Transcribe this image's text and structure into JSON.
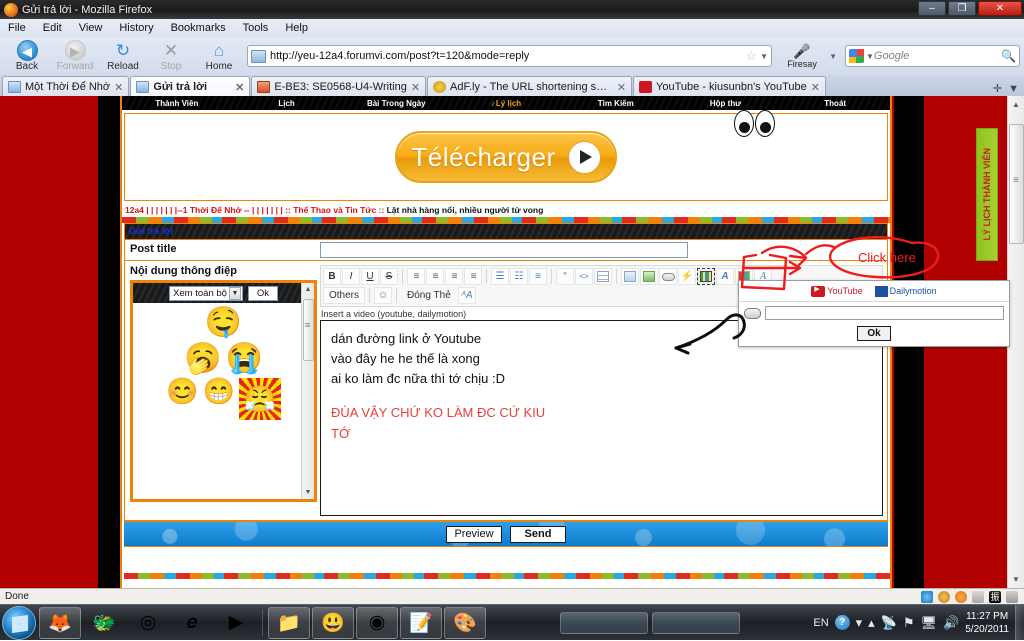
{
  "window": {
    "title": "Gửi trả lời - Mozilla Firefox",
    "minimize": "–",
    "maximize": "❐",
    "close": "✕"
  },
  "menubar": {
    "items": [
      "File",
      "Edit",
      "View",
      "History",
      "Bookmarks",
      "Tools",
      "Help"
    ]
  },
  "navbar": {
    "back": "Back",
    "forward": "Forward",
    "reload": "Reload",
    "stop": "Stop",
    "home": "Home",
    "url": "http://yeu-12a4.forumvi.com/post?t=120&mode=reply",
    "firesay": "Firesay",
    "search_placeholder": "Google"
  },
  "tabs": [
    {
      "label": "Một Thời Để Nhớ",
      "favicon": "page-icon",
      "active": false
    },
    {
      "label": "Gửi trả lời",
      "favicon": "page-icon",
      "active": true
    },
    {
      "label": "E-BE3: SE0568-U4-Writing",
      "favicon": "powerpoint-icon",
      "active": false
    },
    {
      "label": "AdF.ly - The URL shortening servic...",
      "favicon": "adfly-icon",
      "active": false
    },
    {
      "label": "YouTube - kiusunbn's YouTube",
      "favicon": "youtube-icon",
      "active": false
    }
  ],
  "forum": {
    "nav": [
      "Thành Viên",
      "Lịch",
      "Bài Trong Ngày",
      "Lý lịch",
      "Tìm Kiếm",
      "Hộp thư",
      "Thoát"
    ],
    "nav_active_index": 3,
    "banner_button": "Télécharger",
    "breadcrumb_primary": "12a4 | | | | | | |--1 Thời Để Nhớ -- | | | | | | |",
    "breadcrumb_section": ":: Thể Thao và Tin Tức ::",
    "breadcrumb_topic": "Lật nhà hàng nổi, nhiều người tử vong",
    "member_tab": "LÝ LỊCH THÀNH VIÊN"
  },
  "reply_form": {
    "header": "Gửi trả lời",
    "post_title_label": "Post title",
    "post_title_value": "",
    "message_label": "Nội dung thông điệp",
    "hint": "Insert a video (youtube, dailymotion)",
    "preview_button": "Preview",
    "send_button": "Send"
  },
  "smiley_panel": {
    "select_value": "Xem toàn bộ",
    "ok_button": "Ok",
    "dropdown_caret": "▼",
    "rows": [
      [
        "🤤"
      ],
      [
        "🥱",
        "😭"
      ],
      [
        "😊",
        "😁",
        "😤"
      ]
    ]
  },
  "toolbar": {
    "row1": [
      {
        "name": "bold-button",
        "glyph": "B",
        "style": "bold"
      },
      {
        "name": "italic-button",
        "glyph": "I",
        "style": "italic"
      },
      {
        "name": "underline-button",
        "glyph": "U",
        "style": "underline"
      },
      {
        "name": "strike-button",
        "glyph": "S",
        "style": "strike"
      },
      {
        "name": "align-left-button",
        "glyph": "≡"
      },
      {
        "name": "align-center-button",
        "glyph": "≡"
      },
      {
        "name": "align-right-button",
        "glyph": "≡"
      },
      {
        "name": "justify-button",
        "glyph": "≡"
      },
      {
        "name": "bullet-list-button",
        "glyph": "☰"
      },
      {
        "name": "numbered-list-button",
        "glyph": "☷"
      },
      {
        "name": "indent-button",
        "glyph": "≡"
      },
      {
        "name": "quote-button",
        "glyph": "“"
      },
      {
        "name": "code-button",
        "glyph": "<>"
      },
      {
        "name": "insert-table-button",
        "glyph": "⊞"
      },
      {
        "name": "insert-image-button",
        "glyph": "▣"
      },
      {
        "name": "insert-picture-button",
        "glyph": "■"
      },
      {
        "name": "insert-link-button",
        "glyph": "⚭"
      },
      {
        "name": "flash-button",
        "glyph": "⚡"
      },
      {
        "name": "insert-video-button",
        "glyph": "☰"
      },
      {
        "name": "font-style-button",
        "glyph": "A"
      },
      {
        "name": "color-palette-button",
        "glyph": "▦"
      },
      {
        "name": "font-face-button",
        "glyph": "A"
      }
    ],
    "row2": [
      {
        "name": "others-button",
        "label": "Others"
      },
      {
        "name": "smiley-button",
        "label": "☺"
      },
      {
        "name": "close-tags-button",
        "label": "Đóng Thẻ"
      },
      {
        "name": "text-format-button",
        "label": "ᴬA"
      }
    ]
  },
  "message": {
    "lines": [
      "dán đường link ở Youtube",
      "vào đây he he thế là xong",
      "ai ko làm đc nữa thì tớ chịu :D"
    ],
    "red_lines": [
      "ĐÙA VẬY CHỨ KO LÀM ĐC CỨ KIU",
      "TỚ"
    ]
  },
  "video_popup": {
    "youtube_label": "YouTube",
    "dailymotion_label": "Dailymotion",
    "url_value": "",
    "ok_button": "Ok"
  },
  "annotations": {
    "click_here": "Click here"
  },
  "statusbar": {
    "text": "Done"
  },
  "taskbar": {
    "pinned": [
      {
        "name": "taskbar-firefox",
        "glyph": "🦊"
      },
      {
        "name": "taskbar-game",
        "glyph": "🐲"
      },
      {
        "name": "taskbar-chrome",
        "glyph": "◎"
      },
      {
        "name": "taskbar-internet-explorer",
        "glyph": "𝒆"
      },
      {
        "name": "taskbar-media-player",
        "glyph": "▶"
      },
      {
        "name": "taskbar-explorer",
        "glyph": "📁"
      },
      {
        "name": "taskbar-yahoo-messenger",
        "glyph": "😃"
      },
      {
        "name": "taskbar-opera",
        "glyph": "◉"
      },
      {
        "name": "taskbar-notepad",
        "glyph": "📝"
      },
      {
        "name": "taskbar-paint",
        "glyph": "🎨"
      }
    ],
    "language": "EN",
    "help": "?",
    "time": "11:27 PM",
    "date": "5/20/2011"
  }
}
